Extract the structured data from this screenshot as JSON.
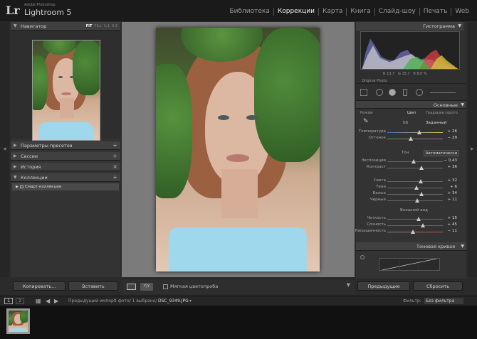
{
  "topbar": {
    "logo": "Lr",
    "brand_small": "Adobe Photoshop",
    "brand_name": "Lightroom 5",
    "modules": [
      "Библиотека",
      "Коррекции",
      "Карта",
      "Книга",
      "Слайд-шоу",
      "Печать",
      "Web"
    ],
    "active_module": "Коррекции"
  },
  "left_panel": {
    "navigator": {
      "title": "Навигатор",
      "opt_fit": "FIT",
      "opt_fill": "FILL",
      "opt_1": "1:1",
      "opt_3": "3:1"
    },
    "presets": {
      "title": "Параметры пресетов"
    },
    "snapshots": {
      "title": "Сессии"
    },
    "history": {
      "title": "История"
    },
    "collections": {
      "title": "Коллекции",
      "item": "Смарт-коллекция"
    }
  },
  "left_buttons": {
    "copy": "Копировать...",
    "paste": "Вставить"
  },
  "toolbar": {
    "soft_proof": "Мягкая цветопроба",
    "yy": "Y|Y"
  },
  "right_panel": {
    "histogram": {
      "title": "Гистограмма",
      "readout_r": "R 13,7",
      "readout_g": "G 15,7",
      "readout_b": "B 8,0 %",
      "original_photo": "Original Photo"
    },
    "basic": {
      "title": "Основные",
      "mode_label": "Режим",
      "mode_color": "Цвет",
      "mode_bw": "Градации серого",
      "wb_label": "ББ",
      "wb_value": "Заданный",
      "tone_label": "Тон",
      "auto_button": "Автоматически",
      "presence_label": "Внешний вид",
      "sliders": [
        {
          "label": "Температура",
          "value": "+ 26",
          "pos": 0.58
        },
        {
          "label": "Оттенок",
          "value": "− 29",
          "pos": 0.42
        },
        {
          "label": "Экспозиция",
          "value": "− 0,43",
          "pos": 0.47
        },
        {
          "label": "Контраст",
          "value": "+ 36",
          "pos": 0.62
        },
        {
          "label": "Света",
          "value": "+ 32",
          "pos": 0.6
        },
        {
          "label": "Тени",
          "value": "+ 6",
          "pos": 0.52
        },
        {
          "label": "Белые",
          "value": "+ 34",
          "pos": 0.62
        },
        {
          "label": "Черные",
          "value": "+ 11",
          "pos": 0.54
        },
        {
          "label": "Четкость",
          "value": "+ 15",
          "pos": 0.56
        },
        {
          "label": "Сочность",
          "value": "+ 45",
          "pos": 0.64
        },
        {
          "label": "Насыщенность",
          "value": "− 11",
          "pos": 0.46
        }
      ]
    },
    "tone_curve": {
      "title": "Тоновая кривая"
    }
  },
  "right_buttons": {
    "previous": "Предыдущие",
    "reset": "Сбросить"
  },
  "filmbar": {
    "page1": "1",
    "page2": "2",
    "source": "Предыдущий импорт",
    "count": "1 фото/  1 выбрано/",
    "filename": "DSC_9349.JPG",
    "filter_label": "Фильтр:",
    "filter_value": "Без фильтра"
  }
}
